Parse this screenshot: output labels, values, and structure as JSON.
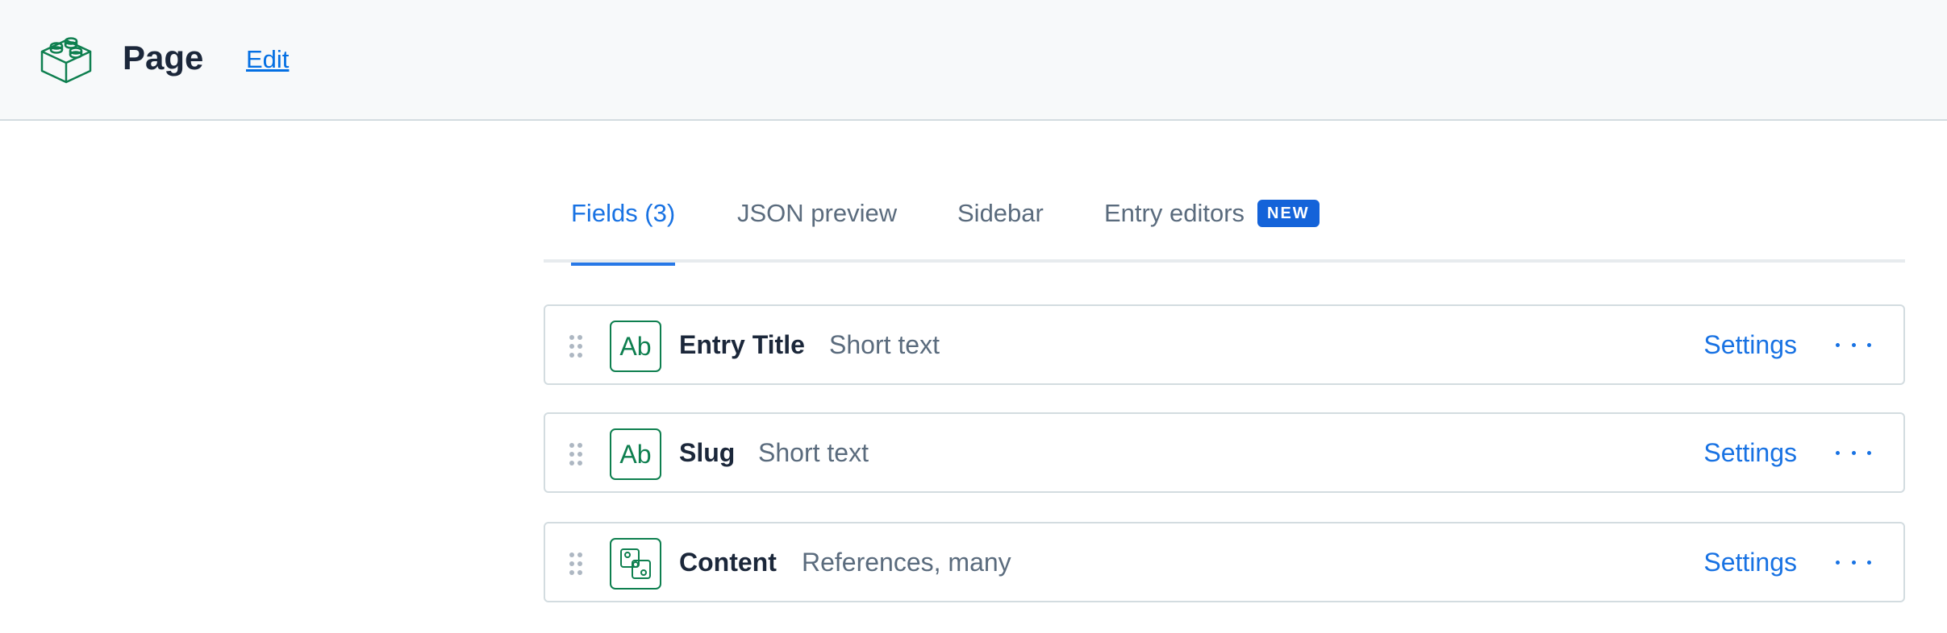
{
  "header": {
    "logo_icon": "content-type-block-icon",
    "title": "Page",
    "edit_label": "Edit"
  },
  "tabs": [
    {
      "label": "Fields (3)",
      "active": true
    },
    {
      "label": "JSON preview",
      "active": false
    },
    {
      "label": "Sidebar",
      "active": false
    },
    {
      "label": "Entry editors",
      "active": false,
      "badge": "NEW"
    }
  ],
  "fields": [
    {
      "name": "Entry Title",
      "type": "Short text",
      "icon": "text-field-icon",
      "icon_text": "Ab",
      "settings_label": "Settings"
    },
    {
      "name": "Slug",
      "type": "Short text",
      "icon": "text-field-icon",
      "icon_text": "Ab",
      "settings_label": "Settings"
    },
    {
      "name": "Content",
      "type": "References, many",
      "icon": "references-field-icon",
      "settings_label": "Settings"
    }
  ],
  "colors": {
    "accent": "#1872e3",
    "badge": "#1463d9",
    "field_icon": "#0e7f4f",
    "header_bg": "#f7f9fa"
  }
}
